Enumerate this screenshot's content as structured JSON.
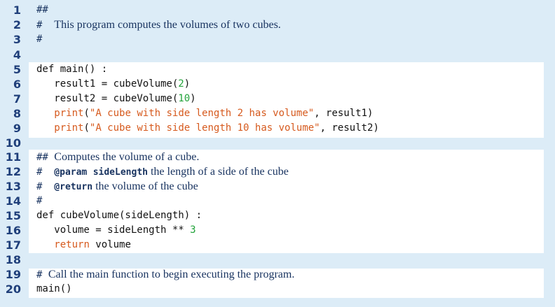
{
  "lines": [
    {
      "n": "1",
      "parts": [
        {
          "t": "##",
          "c": "hash"
        }
      ]
    },
    {
      "n": "2",
      "parts": [
        {
          "t": "#  ",
          "c": "hash"
        },
        {
          "t": "This program computes the volumes of two cubes.",
          "c": "cmt"
        }
      ]
    },
    {
      "n": "3",
      "parts": [
        {
          "t": "#",
          "c": "hash"
        }
      ]
    },
    {
      "n": "4",
      "parts": []
    },
    {
      "n": "5",
      "parts": [
        {
          "t": "def main() :",
          "c": ""
        }
      ]
    },
    {
      "n": "6",
      "parts": [
        {
          "t": "   result1 = cubeVolume(",
          "c": ""
        },
        {
          "t": "2",
          "c": "num"
        },
        {
          "t": ")",
          "c": ""
        }
      ]
    },
    {
      "n": "7",
      "parts": [
        {
          "t": "   result2 = cubeVolume(",
          "c": ""
        },
        {
          "t": "10",
          "c": "num"
        },
        {
          "t": ")",
          "c": ""
        }
      ]
    },
    {
      "n": "8",
      "parts": [
        {
          "t": "   ",
          "c": ""
        },
        {
          "t": "print",
          "c": "kw"
        },
        {
          "t": "(",
          "c": ""
        },
        {
          "t": "\"A cube with side length 2 has volume\"",
          "c": "str"
        },
        {
          "t": ", result1)",
          "c": ""
        }
      ]
    },
    {
      "n": "9",
      "parts": [
        {
          "t": "   ",
          "c": ""
        },
        {
          "t": "print",
          "c": "kw"
        },
        {
          "t": "(",
          "c": ""
        },
        {
          "t": "\"A cube with side length 10 has volume\"",
          "c": "str"
        },
        {
          "t": ", result2)",
          "c": ""
        }
      ]
    },
    {
      "n": "10",
      "parts": []
    },
    {
      "n": "11",
      "parts": [
        {
          "t": "## ",
          "c": "hash"
        },
        {
          "t": "Computes the volume of a cube.",
          "c": "cmt"
        }
      ]
    },
    {
      "n": "12",
      "parts": [
        {
          "t": "#  ",
          "c": "hash"
        },
        {
          "t": "@param",
          "c": "tag"
        },
        {
          "t": " ",
          "c": ""
        },
        {
          "t": "sideLength",
          "c": "param"
        },
        {
          "t": " the length of a side of the cube",
          "c": "cmt"
        }
      ]
    },
    {
      "n": "13",
      "parts": [
        {
          "t": "#  ",
          "c": "hash"
        },
        {
          "t": "@return",
          "c": "tag"
        },
        {
          "t": " the volume of the cube",
          "c": "cmt"
        }
      ]
    },
    {
      "n": "14",
      "parts": [
        {
          "t": "#",
          "c": "hash"
        }
      ]
    },
    {
      "n": "15",
      "parts": [
        {
          "t": "def cubeVolume(sideLength) :",
          "c": ""
        }
      ]
    },
    {
      "n": "16",
      "parts": [
        {
          "t": "   volume = sideLength ** ",
          "c": ""
        },
        {
          "t": "3",
          "c": "num"
        }
      ]
    },
    {
      "n": "17",
      "parts": [
        {
          "t": "   ",
          "c": ""
        },
        {
          "t": "return",
          "c": "ret"
        },
        {
          "t": " volume",
          "c": ""
        }
      ]
    },
    {
      "n": "18",
      "parts": []
    },
    {
      "n": "19",
      "parts": [
        {
          "t": "# ",
          "c": "hash"
        },
        {
          "t": "Call the main function to begin executing the program.",
          "c": "cmt"
        }
      ]
    },
    {
      "n": "20",
      "parts": [
        {
          "t": "main()",
          "c": ""
        }
      ]
    }
  ],
  "colors": {
    "background": "#dcecf7",
    "box": "#ffffff",
    "line_number": "#1f3f7a",
    "comment": "#17325f",
    "number": "#22a33a",
    "string": "#d65a1e"
  }
}
